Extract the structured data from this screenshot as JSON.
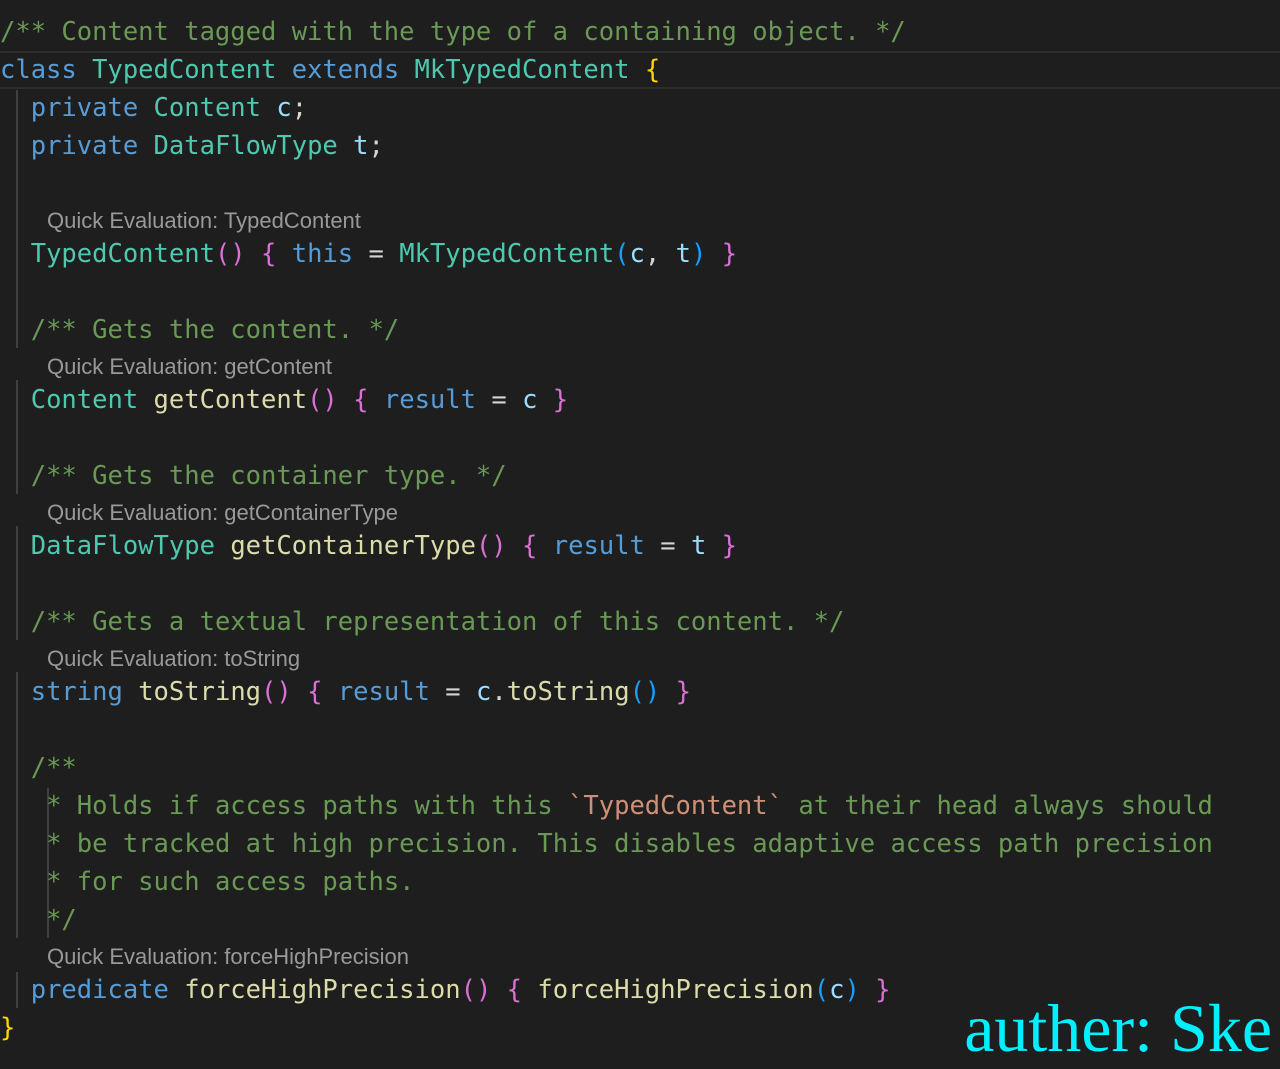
{
  "editor": {
    "colors": {
      "background": "#1e1e1e",
      "comment": "#6a9955",
      "keyword": "#569cd6",
      "type": "#4ec9b0",
      "function": "#dcdcaa",
      "variable": "#9cdcfe",
      "string": "#ce9178",
      "text": "#d4d4d4",
      "bracket_gold": "#ffd700",
      "bracket_pink": "#da70d6",
      "bracket_blue": "#179fff",
      "codelens": "#999999"
    },
    "lines": [
      [
        [
          "/** Content tagged with the type of a containing object. */",
          "comment"
        ]
      ],
      [
        [
          "class",
          "keyword"
        ],
        [
          " ",
          "text"
        ],
        [
          "TypedContent",
          "type"
        ],
        [
          " ",
          "text"
        ],
        [
          "extends",
          "keyword"
        ],
        [
          " ",
          "text"
        ],
        [
          "MkTypedContent",
          "type"
        ],
        [
          " ",
          "text"
        ],
        [
          "{",
          "bracket_gold"
        ]
      ],
      [
        [
          "  ",
          "text"
        ],
        [
          "private",
          "keyword"
        ],
        [
          " ",
          "text"
        ],
        [
          "Content",
          "type"
        ],
        [
          " ",
          "text"
        ],
        [
          "c",
          "variable"
        ],
        [
          ";",
          "text"
        ]
      ],
      [
        [
          "  ",
          "text"
        ],
        [
          "private",
          "keyword"
        ],
        [
          " ",
          "text"
        ],
        [
          "DataFlowType",
          "type"
        ],
        [
          " ",
          "text"
        ],
        [
          "t",
          "variable"
        ],
        [
          ";",
          "text"
        ]
      ],
      [
        [
          "",
          "text"
        ]
      ],
      [
        [
          "  ",
          "text"
        ],
        [
          "TypedContent",
          "type"
        ],
        [
          "()",
          "bracket_pink"
        ],
        [
          " ",
          "text"
        ],
        [
          "{",
          "bracket_pink"
        ],
        [
          " ",
          "text"
        ],
        [
          "this",
          "keyword"
        ],
        [
          " = ",
          "text"
        ],
        [
          "MkTypedContent",
          "type"
        ],
        [
          "(",
          "bracket_blue"
        ],
        [
          "c",
          "variable"
        ],
        [
          ", ",
          "text"
        ],
        [
          "t",
          "variable"
        ],
        [
          ")",
          "bracket_blue"
        ],
        [
          " ",
          "text"
        ],
        [
          "}",
          "bracket_pink"
        ]
      ],
      [
        [
          "",
          "text"
        ]
      ],
      [
        [
          "  ",
          "text"
        ],
        [
          "/** Gets the content. */",
          "comment"
        ]
      ],
      [
        [
          "  ",
          "text"
        ],
        [
          "Content",
          "type"
        ],
        [
          " ",
          "text"
        ],
        [
          "getContent",
          "function"
        ],
        [
          "()",
          "bracket_pink"
        ],
        [
          " ",
          "text"
        ],
        [
          "{",
          "bracket_pink"
        ],
        [
          " ",
          "text"
        ],
        [
          "result",
          "keyword"
        ],
        [
          " = ",
          "text"
        ],
        [
          "c",
          "variable"
        ],
        [
          " ",
          "text"
        ],
        [
          "}",
          "bracket_pink"
        ]
      ],
      [
        [
          "",
          "text"
        ]
      ],
      [
        [
          "  ",
          "text"
        ],
        [
          "/** Gets the container type. */",
          "comment"
        ]
      ],
      [
        [
          "  ",
          "text"
        ],
        [
          "DataFlowType",
          "type"
        ],
        [
          " ",
          "text"
        ],
        [
          "getContainerType",
          "function"
        ],
        [
          "()",
          "bracket_pink"
        ],
        [
          " ",
          "text"
        ],
        [
          "{",
          "bracket_pink"
        ],
        [
          " ",
          "text"
        ],
        [
          "result",
          "keyword"
        ],
        [
          " = ",
          "text"
        ],
        [
          "t",
          "variable"
        ],
        [
          " ",
          "text"
        ],
        [
          "}",
          "bracket_pink"
        ]
      ],
      [
        [
          "",
          "text"
        ]
      ],
      [
        [
          "  ",
          "text"
        ],
        [
          "/** Gets a textual representation of this content. */",
          "comment"
        ]
      ],
      [
        [
          "  ",
          "text"
        ],
        [
          "string",
          "keyword"
        ],
        [
          " ",
          "text"
        ],
        [
          "toString",
          "function"
        ],
        [
          "()",
          "bracket_pink"
        ],
        [
          " ",
          "text"
        ],
        [
          "{",
          "bracket_pink"
        ],
        [
          " ",
          "text"
        ],
        [
          "result",
          "keyword"
        ],
        [
          " = ",
          "text"
        ],
        [
          "c",
          "variable"
        ],
        [
          ".",
          "text"
        ],
        [
          "toString",
          "function"
        ],
        [
          "()",
          "bracket_blue"
        ],
        [
          " ",
          "text"
        ],
        [
          "}",
          "bracket_pink"
        ]
      ],
      [
        [
          "",
          "text"
        ]
      ],
      [
        [
          "  ",
          "text"
        ],
        [
          "/**",
          "comment"
        ]
      ],
      [
        [
          "   ",
          "text"
        ],
        [
          "* Holds if access paths with this ",
          "comment"
        ],
        [
          "`TypedContent`",
          "string"
        ],
        [
          " at their head always should",
          "comment"
        ]
      ],
      [
        [
          "   ",
          "text"
        ],
        [
          "* be tracked at high precision. This disables adaptive access path precision",
          "comment"
        ]
      ],
      [
        [
          "   ",
          "text"
        ],
        [
          "* for such access paths.",
          "comment"
        ]
      ],
      [
        [
          "   ",
          "text"
        ],
        [
          "*/",
          "comment"
        ]
      ],
      [
        [
          "  ",
          "text"
        ],
        [
          "predicate",
          "keyword"
        ],
        [
          " ",
          "text"
        ],
        [
          "forceHighPrecision",
          "function"
        ],
        [
          "()",
          "bracket_pink"
        ],
        [
          " ",
          "text"
        ],
        [
          "{",
          "bracket_pink"
        ],
        [
          " ",
          "text"
        ],
        [
          "forceHighPrecision",
          "function"
        ],
        [
          "(",
          "bracket_blue"
        ],
        [
          "c",
          "variable"
        ],
        [
          ")",
          "bracket_blue"
        ],
        [
          " ",
          "text"
        ],
        [
          "}",
          "bracket_pink"
        ]
      ],
      [
        [
          "}",
          "bracket_gold"
        ]
      ]
    ],
    "codelens": [
      "Quick Evaluation: TypedContent",
      "Quick Evaluation: getContent",
      "Quick Evaluation: getContainerType",
      "Quick Evaluation: toString",
      "Quick Evaluation: forceHighPrecision"
    ]
  },
  "watermark": {
    "text": "auther: Ske",
    "color": "#00f0ff"
  }
}
